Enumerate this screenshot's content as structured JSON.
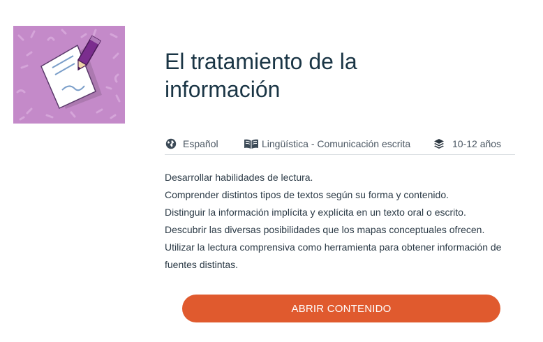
{
  "card": {
    "thumbnail_icon": "paper-and-pencil-icon",
    "thumbnail_bg": "#c48ac9",
    "title": "El tratamiento de la información",
    "meta": {
      "language": {
        "icon": "globe-icon",
        "label": "Español"
      },
      "subject": {
        "icon": "open-book-icon",
        "label": "Lingüística - Comunicación escrita"
      },
      "age": {
        "icon": "layers-icon",
        "label": "10-12 años"
      }
    },
    "objectives": [
      "Desarrollar habilidades de lectura.",
      "Comprender distintos tipos de textos según su forma y contenido.",
      "Distinguir la información implícita y explícita en un texto oral o escrito.",
      "Descubrir las diversas posibilidades que los mapas conceptuales ofrecen.",
      "Utilizar la lectura comprensiva como herramienta para obtener información de fuentes distintas."
    ],
    "button_label": "ABRIR CONTENIDO",
    "colors": {
      "accent": "#e05a2e",
      "title": "#1a3545"
    }
  }
}
